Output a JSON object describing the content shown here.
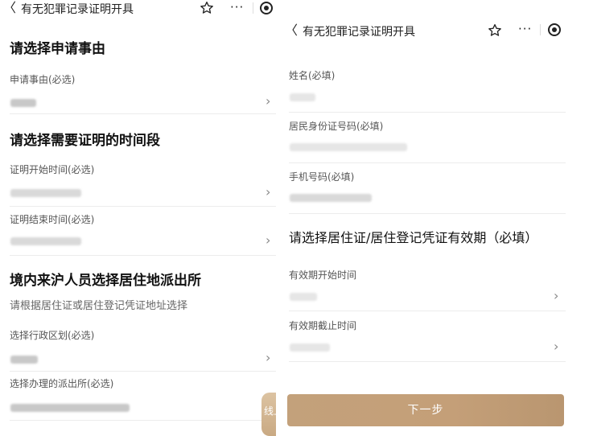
{
  "left_screen": {
    "nav": {
      "back_glyph": "〈",
      "title": "有无犯罪记录证明开具",
      "star_icon": "star-outline-icon",
      "more_glyph": "···",
      "target_icon": "target-icon"
    },
    "section_reason": {
      "title": "请选择申请事由",
      "field_label": "申请事由(必选)",
      "value": ""
    },
    "section_period": {
      "title": "请选择需要证明的时间段",
      "start_label": "证明开始时间(必选)",
      "start_value": "",
      "end_label": "证明结束时间(必选)",
      "end_value": ""
    },
    "section_station": {
      "title": "境内来沪人员选择居住地派出所",
      "hint": "请根据居住证或居住登记凭证地址选择",
      "district_label": "选择行政区划(必选)",
      "district_value": "",
      "station_label": "选择办理的派出所(必选)",
      "station_value": ""
    },
    "chevron_glyph": "›",
    "side_tab_label": "线上"
  },
  "right_screen": {
    "nav": {
      "back_glyph": "〈",
      "title": "有无犯罪记录证明开具",
      "star_icon": "star-outline-icon",
      "more_glyph": "···",
      "target_icon": "target-icon"
    },
    "fields": {
      "name_label": "姓名(必填)",
      "name_value": "",
      "id_label": "居民身份证号码(必填)",
      "id_value": "",
      "phone_label": "手机号码(必填)",
      "phone_value": ""
    },
    "validity": {
      "title": "请选择居住证/居住登记凭证有效期（必填）",
      "start_label": "有效期开始时间",
      "start_value": "",
      "end_label": "有效期截止时间",
      "end_value": ""
    },
    "chevron_glyph": "›",
    "next_button_label": "下一步"
  },
  "colors": {
    "accent_gold": "#c3a17b",
    "separator": "#ececec",
    "text_primary": "#111111",
    "text_secondary": "#555555"
  }
}
